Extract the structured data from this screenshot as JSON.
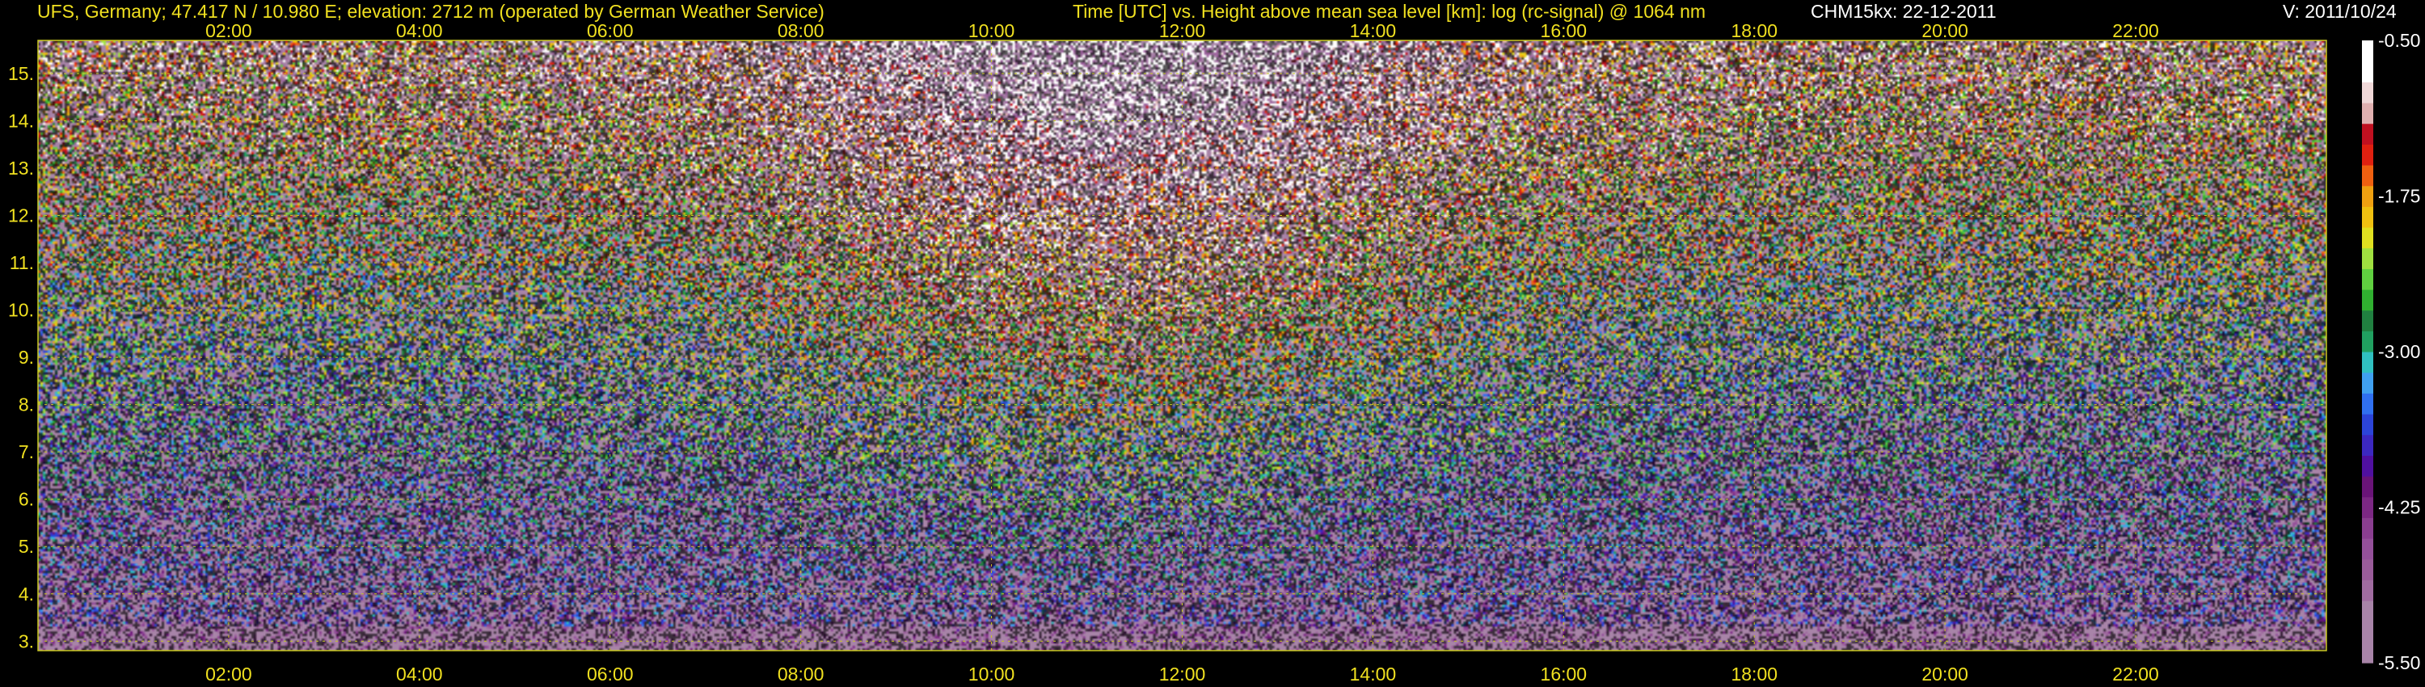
{
  "header": {
    "station": "UFS, Germany; 47.417 N / 10.980 E; elevation: 2712 m  (operated by German Weather Service)",
    "title": "Time [UTC] vs. Height above mean sea level [km]: log (rc-signal) @ 1064 nm",
    "instrument": "CHM15kx: 22-12-2011",
    "version": "V: 2011/10/24"
  },
  "colors": {
    "text_yellow": "#f0e020",
    "text_white": "#ffffff",
    "background": "#000000",
    "grid": "#c8c820"
  },
  "chart_data": {
    "type": "heatmap",
    "title": "Time [UTC] vs. Height above mean sea level [km]: log (rc-signal) @ 1064 nm",
    "xlabel": "",
    "ylabel": "",
    "xlim": [
      "00:00",
      "24:00"
    ],
    "ylim": [
      2.8,
      15.7
    ],
    "x_ticks": [
      "02:00",
      "04:00",
      "06:00",
      "08:00",
      "10:00",
      "12:00",
      "14:00",
      "16:00",
      "18:00",
      "20:00",
      "22:00"
    ],
    "x_tick_hours": [
      2,
      4,
      6,
      8,
      10,
      12,
      14,
      16,
      18,
      20,
      22
    ],
    "y_ticks": [
      "3.",
      "4.",
      "5.",
      "6.",
      "7.",
      "8.",
      "9.",
      "10.",
      "11.",
      "12.",
      "13.",
      "14.",
      "15."
    ],
    "y_tick_values": [
      3,
      4,
      5,
      6,
      7,
      8,
      9,
      10,
      11,
      12,
      13,
      14,
      15
    ],
    "grid": true,
    "colorbar": {
      "ticks": [
        "-0.50",
        "-1.75",
        "-3.00",
        "-4.25",
        "-5.50"
      ],
      "tick_values": [
        -0.5,
        -1.75,
        -3.0,
        -4.25,
        -5.5
      ],
      "range": [
        -5.5,
        -0.5
      ],
      "colors": [
        "#a884a8",
        "#a884a8",
        "#a884a8",
        "#a06ca0",
        "#9a5c9a",
        "#94509a",
        "#8a3e90",
        "#7c2884",
        "#6a1478",
        "#5010a0",
        "#3c28c0",
        "#2c44d8",
        "#3070f0",
        "#40a0f0",
        "#30c0c0",
        "#20a060",
        "#208040",
        "#30b030",
        "#60d040",
        "#a0e040",
        "#e0e020",
        "#f0c010",
        "#f0a010",
        "#f06010",
        "#e02010",
        "#c01020",
        "#e0b0b0",
        "#f0d8d8",
        "#ffffff",
        "#ffffff"
      ]
    }
  }
}
